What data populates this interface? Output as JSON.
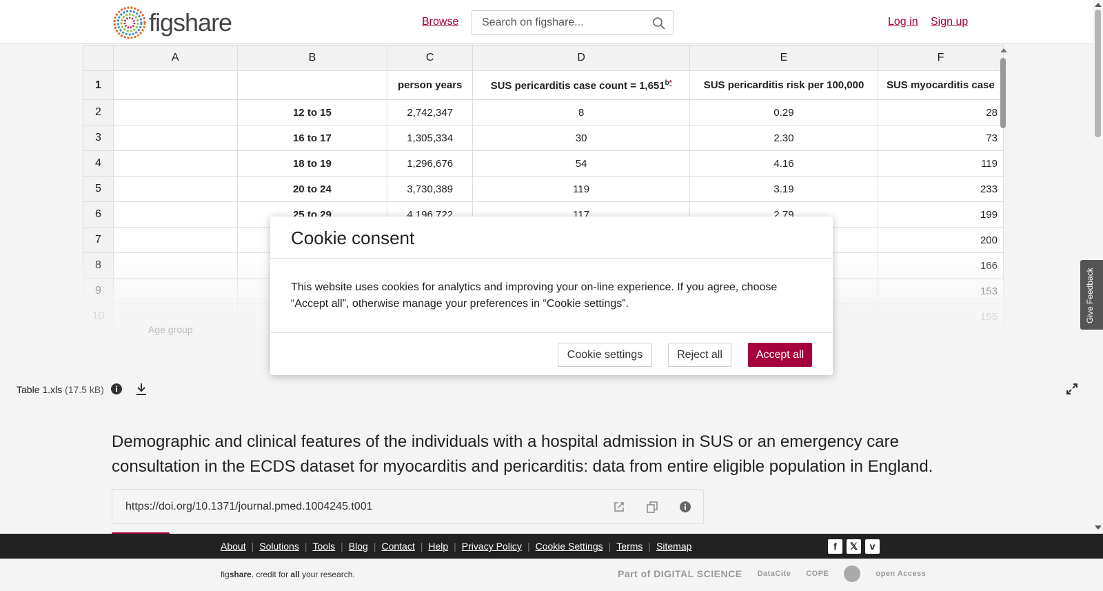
{
  "header": {
    "logo_text": "figshare",
    "browse_label": "Browse",
    "search_placeholder": "Search on figshare...",
    "login_label": "Log in",
    "signup_label": "Sign up"
  },
  "sheet": {
    "columns": [
      "A",
      "B",
      "C",
      "D",
      "E",
      "F"
    ],
    "header_row": {
      "num": "1",
      "c": "person years",
      "d": "SUS pericarditis case count = 1,651",
      "d_sup_b": "b",
      "d_sup_star": "*",
      "e": "SUS pericarditis risk per 100,000",
      "f": "SUS myocarditis case"
    },
    "rows": [
      {
        "num": "2",
        "b": "12 to 15",
        "c": "2,742,347",
        "d": "8",
        "e": "0.29",
        "f": "28"
      },
      {
        "num": "3",
        "b": "16 to 17",
        "c": "1,305,334",
        "d": "30",
        "e": "2.30",
        "f": "73"
      },
      {
        "num": "4",
        "b": "18 to 19",
        "c": "1,296,676",
        "d": "54",
        "e": "4.16",
        "f": "119"
      },
      {
        "num": "5",
        "b": "20 to 24",
        "c": "3,730,389",
        "d": "119",
        "e": "3.19",
        "f": "233"
      },
      {
        "num": "6",
        "b": "25 to 29",
        "c": "4,196,722",
        "d": "117",
        "e": "2.79",
        "f": "199"
      },
      {
        "num": "7",
        "b": "",
        "c": "",
        "d": "",
        "e": "",
        "f": "200"
      },
      {
        "num": "8",
        "b": "",
        "c": "",
        "d": "",
        "e": "",
        "f": "166"
      },
      {
        "num": "9",
        "b": "",
        "c": "",
        "d": "",
        "e": "",
        "f": "153"
      },
      {
        "num": "10",
        "b": "",
        "c": "",
        "d": "",
        "e": "",
        "f": "155"
      }
    ],
    "age_group_label": "Age group"
  },
  "file": {
    "name": "Table 1.xls",
    "size": "(17.5 kB)"
  },
  "item": {
    "title": "Demographic and clinical features of the individuals with a hospital admission in SUS or an emergency care consultation in the ECDS dataset for myocarditis and pericarditis: data from entire eligible population in England.",
    "doi": "https://doi.org/10.1371/journal.pmed.1004245.t001"
  },
  "feedback_label": "Give Feedback",
  "footer": {
    "links": [
      "About",
      "Solutions",
      "Tools",
      "Blog",
      "Contact",
      "Help",
      "Privacy Policy",
      "Cookie Settings",
      "Terms",
      "Sitemap"
    ],
    "credit_pre": "fig",
    "credit_bold": "share",
    "credit_mid": ". credit for ",
    "credit_all": "all",
    "credit_post": " your research.",
    "social": [
      "facebook-icon",
      "x-icon",
      "vimeo-icon"
    ],
    "partners": {
      "digital_science": "Part of DIGITAL SCIENCE",
      "datacite": "DataCite",
      "cope": "COPE",
      "open_access": "open Access"
    }
  },
  "cookie_modal": {
    "title": "Cookie consent",
    "body": "This website uses cookies for analytics and improving your on-line experience. If you agree, choose “Accept all”, otherwise manage your preferences in “Cookie settings”.",
    "settings_label": "Cookie settings",
    "reject_label": "Reject all",
    "accept_label": "Accept all"
  },
  "colors": {
    "brand": "#a5003c",
    "footer_bg": "#222222"
  }
}
